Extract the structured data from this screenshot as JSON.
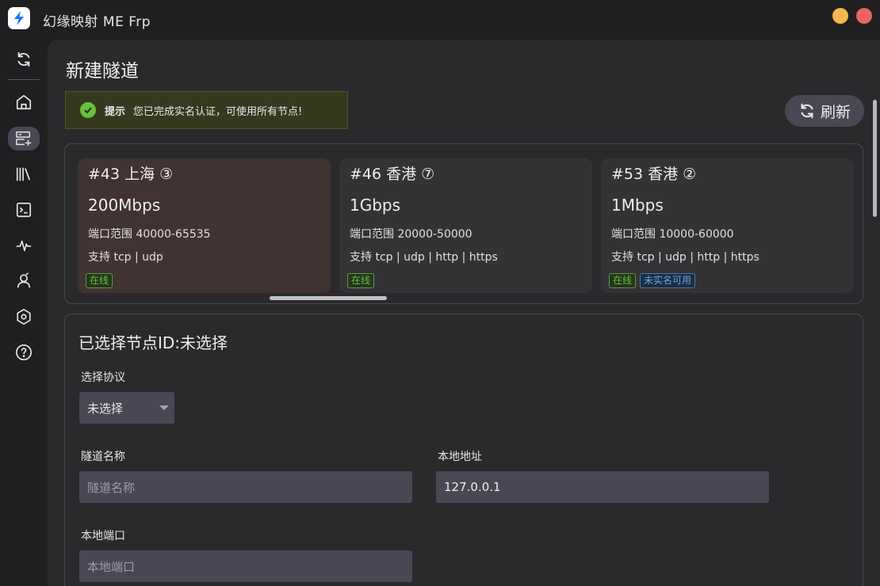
{
  "app": {
    "title": "幻缘映射 ME Frp"
  },
  "sidebar": {
    "items": [
      {
        "name": "refresh"
      },
      {
        "name": "home"
      },
      {
        "name": "new-tunnel",
        "active": true
      },
      {
        "name": "library"
      },
      {
        "name": "terminal"
      },
      {
        "name": "status"
      },
      {
        "name": "user"
      },
      {
        "name": "settings"
      },
      {
        "name": "help"
      }
    ]
  },
  "page": {
    "title": "新建隧道",
    "refresh_label": "刷新"
  },
  "tip": {
    "title": "提示",
    "text": "您已完成实名认证，可使用所有节点!"
  },
  "nodes": [
    {
      "title": "#43 上海 ③",
      "speed": "200Mbps",
      "port_range": "端口范围 40000-65535",
      "protocols": "支持 tcp | udp",
      "tags": [
        "在线"
      ]
    },
    {
      "title": "#46 香港 ⑦",
      "speed": "1Gbps",
      "port_range": "端口范围 20000-50000",
      "protocols": "支持 tcp | udp | http | https",
      "tags": [
        "在线"
      ]
    },
    {
      "title": "#53 香港 ②",
      "speed": "1Mbps",
      "port_range": "端口范围 10000-60000",
      "protocols": "支持 tcp | udp | http | https",
      "tags": [
        "在线",
        "未实名可用"
      ]
    }
  ],
  "form": {
    "selected_node": "已选择节点ID:未选择",
    "protocol_label": "选择协议",
    "protocol_value": "未选择",
    "tunnel_name_label": "隧道名称",
    "tunnel_name_placeholder": "隧道名称",
    "local_addr_label": "本地地址",
    "local_addr_value": "127.0.0.1",
    "local_port_label": "本地端口",
    "local_port_placeholder": "本地端口"
  },
  "colors": {
    "accent": "#4a4754",
    "success": "#67c23a",
    "info": "#5aa8ee",
    "window_min": "#f4b94e",
    "window_close": "#ef6461"
  }
}
